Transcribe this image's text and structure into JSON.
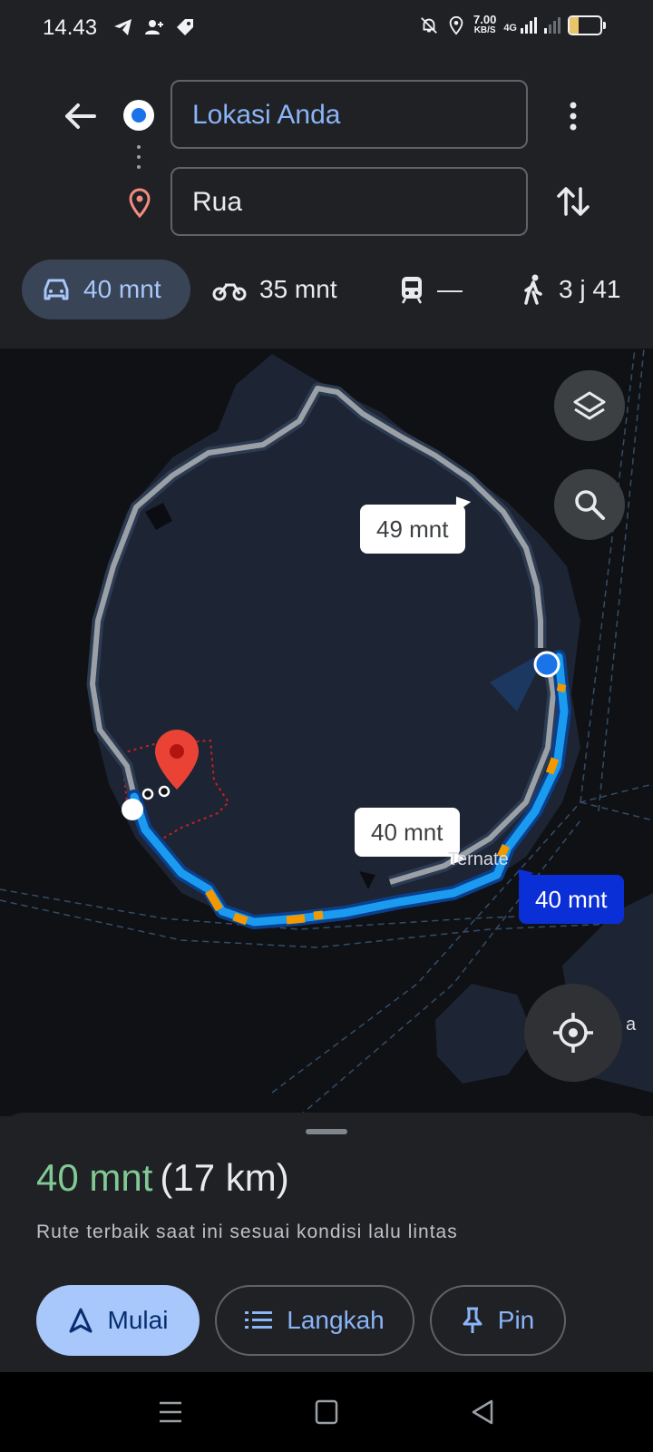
{
  "status_bar": {
    "time": "14.43",
    "speed_value": "7.00",
    "speed_unit": "KB/S",
    "network": "4G",
    "battery": "28"
  },
  "directions": {
    "origin_value": "Lokasi Anda",
    "destination_value": "Rua"
  },
  "modes": [
    {
      "icon": "car-icon",
      "label": "40 mnt",
      "active": true
    },
    {
      "icon": "motorcycle-icon",
      "label": "35 mnt"
    },
    {
      "icon": "transit-icon",
      "label": "—"
    },
    {
      "icon": "walk-icon",
      "label": "3 j 41"
    }
  ],
  "map": {
    "alt_route_1_time": "49 mnt",
    "alt_route_2_time": "40 mnt",
    "main_route_time": "40 mnt",
    "place_label": "Ternate",
    "edge_label": "a",
    "colors": {
      "route": "#1a9bf0",
      "route_alt": "#9aa0a6",
      "traffic": "#f29900",
      "pin": "#ea4335"
    }
  },
  "summary": {
    "duration": "40 mnt",
    "distance": "(17 km)",
    "description": "Rute terbaik saat ini sesuai kondisi lalu lintas"
  },
  "actions": {
    "start_label": "Mulai",
    "steps_label": "Langkah",
    "pin_label": "Pin"
  }
}
